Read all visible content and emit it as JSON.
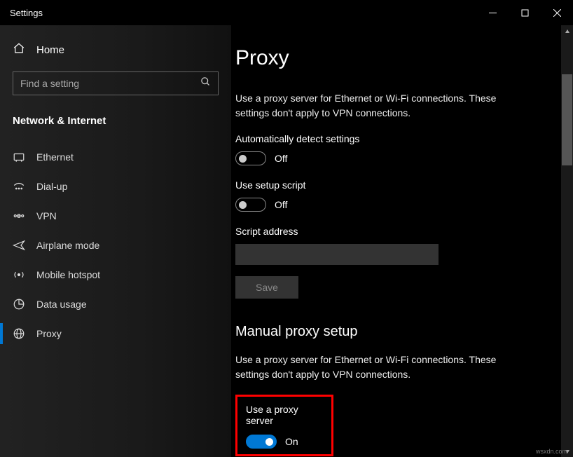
{
  "window": {
    "title": "Settings"
  },
  "sidebar": {
    "home_label": "Home",
    "search_placeholder": "Find a setting",
    "section_label": "Network & Internet",
    "items": [
      {
        "label": "Ethernet"
      },
      {
        "label": "Dial-up"
      },
      {
        "label": "VPN"
      },
      {
        "label": "Airplane mode"
      },
      {
        "label": "Mobile hotspot"
      },
      {
        "label": "Data usage"
      },
      {
        "label": "Proxy"
      }
    ]
  },
  "main": {
    "title": "Proxy",
    "desc": "Use a proxy server for Ethernet or Wi-Fi connections. These settings don't apply to VPN connections.",
    "auto_detect_label": "Automatically detect settings",
    "auto_detect_state": "Off",
    "use_script_label": "Use setup script",
    "use_script_state": "Off",
    "script_address_label": "Script address",
    "script_address_value": "",
    "save_label": "Save",
    "manual_heading": "Manual proxy setup",
    "manual_desc": "Use a proxy server for Ethernet or Wi-Fi connections. These settings don't apply to VPN connections.",
    "use_proxy_label": "Use a proxy server",
    "use_proxy_state": "On"
  },
  "watermark": "wsxdn.com"
}
